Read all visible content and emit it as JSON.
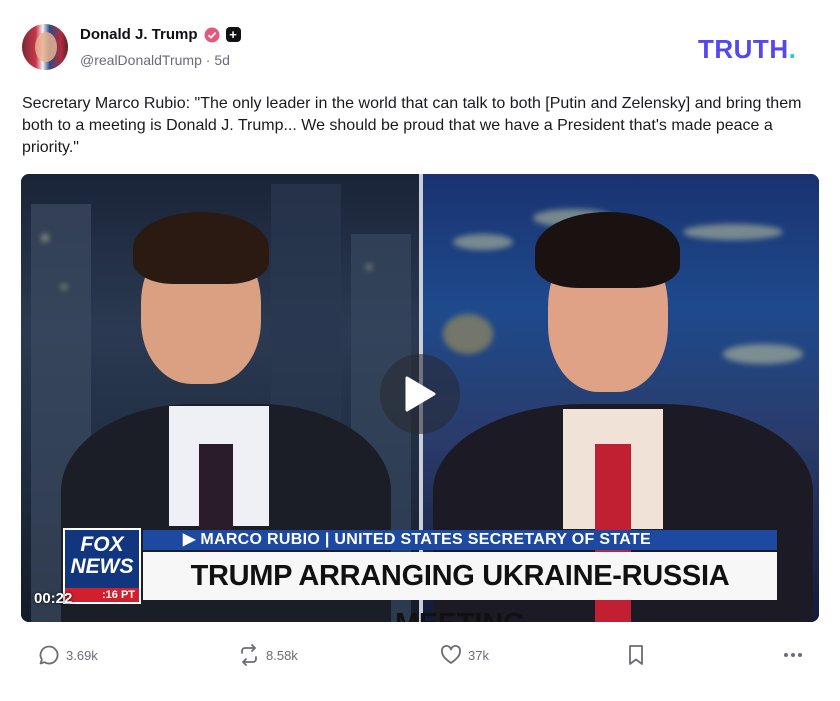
{
  "post": {
    "author_name": "Donald J. Trump",
    "handle": "@realDonaldTrump",
    "separator": "·",
    "age": "5d",
    "brand_text": "TRUTH",
    "brand_dot": ".",
    "text": "Secretary Marco Rubio: \"The only leader in the world that can talk to both [Putin and Zelensky] and bring them both to a meeting is Donald J. Trump... We should be proud that we have a President that's made peace a priority.\""
  },
  "video": {
    "timestamp": "00:22",
    "lower_third": {
      "logo_top": "FOX",
      "logo_bottom": "NEWS",
      "logo_time": ":16 PT",
      "name_line": "▶ MARCO RUBIO | UNITED STATES SECRETARY OF STATE",
      "headline": "TRUMP ARRANGING UKRAINE-RUSSIA MEETING"
    }
  },
  "actions": {
    "replies": "3.69k",
    "retruths": "8.58k",
    "likes": "37k"
  },
  "colors": {
    "brand": "#5448ee",
    "brand_dot": "#1ed3c4",
    "verified": "#e4587d",
    "fox_blue": "#12367e",
    "fox_red": "#d0202e"
  },
  "icons": [
    "verified-badge-icon",
    "plus-badge-icon",
    "play-icon",
    "reply-icon",
    "retruth-icon",
    "like-icon",
    "bookmark-icon",
    "more-icon"
  ]
}
